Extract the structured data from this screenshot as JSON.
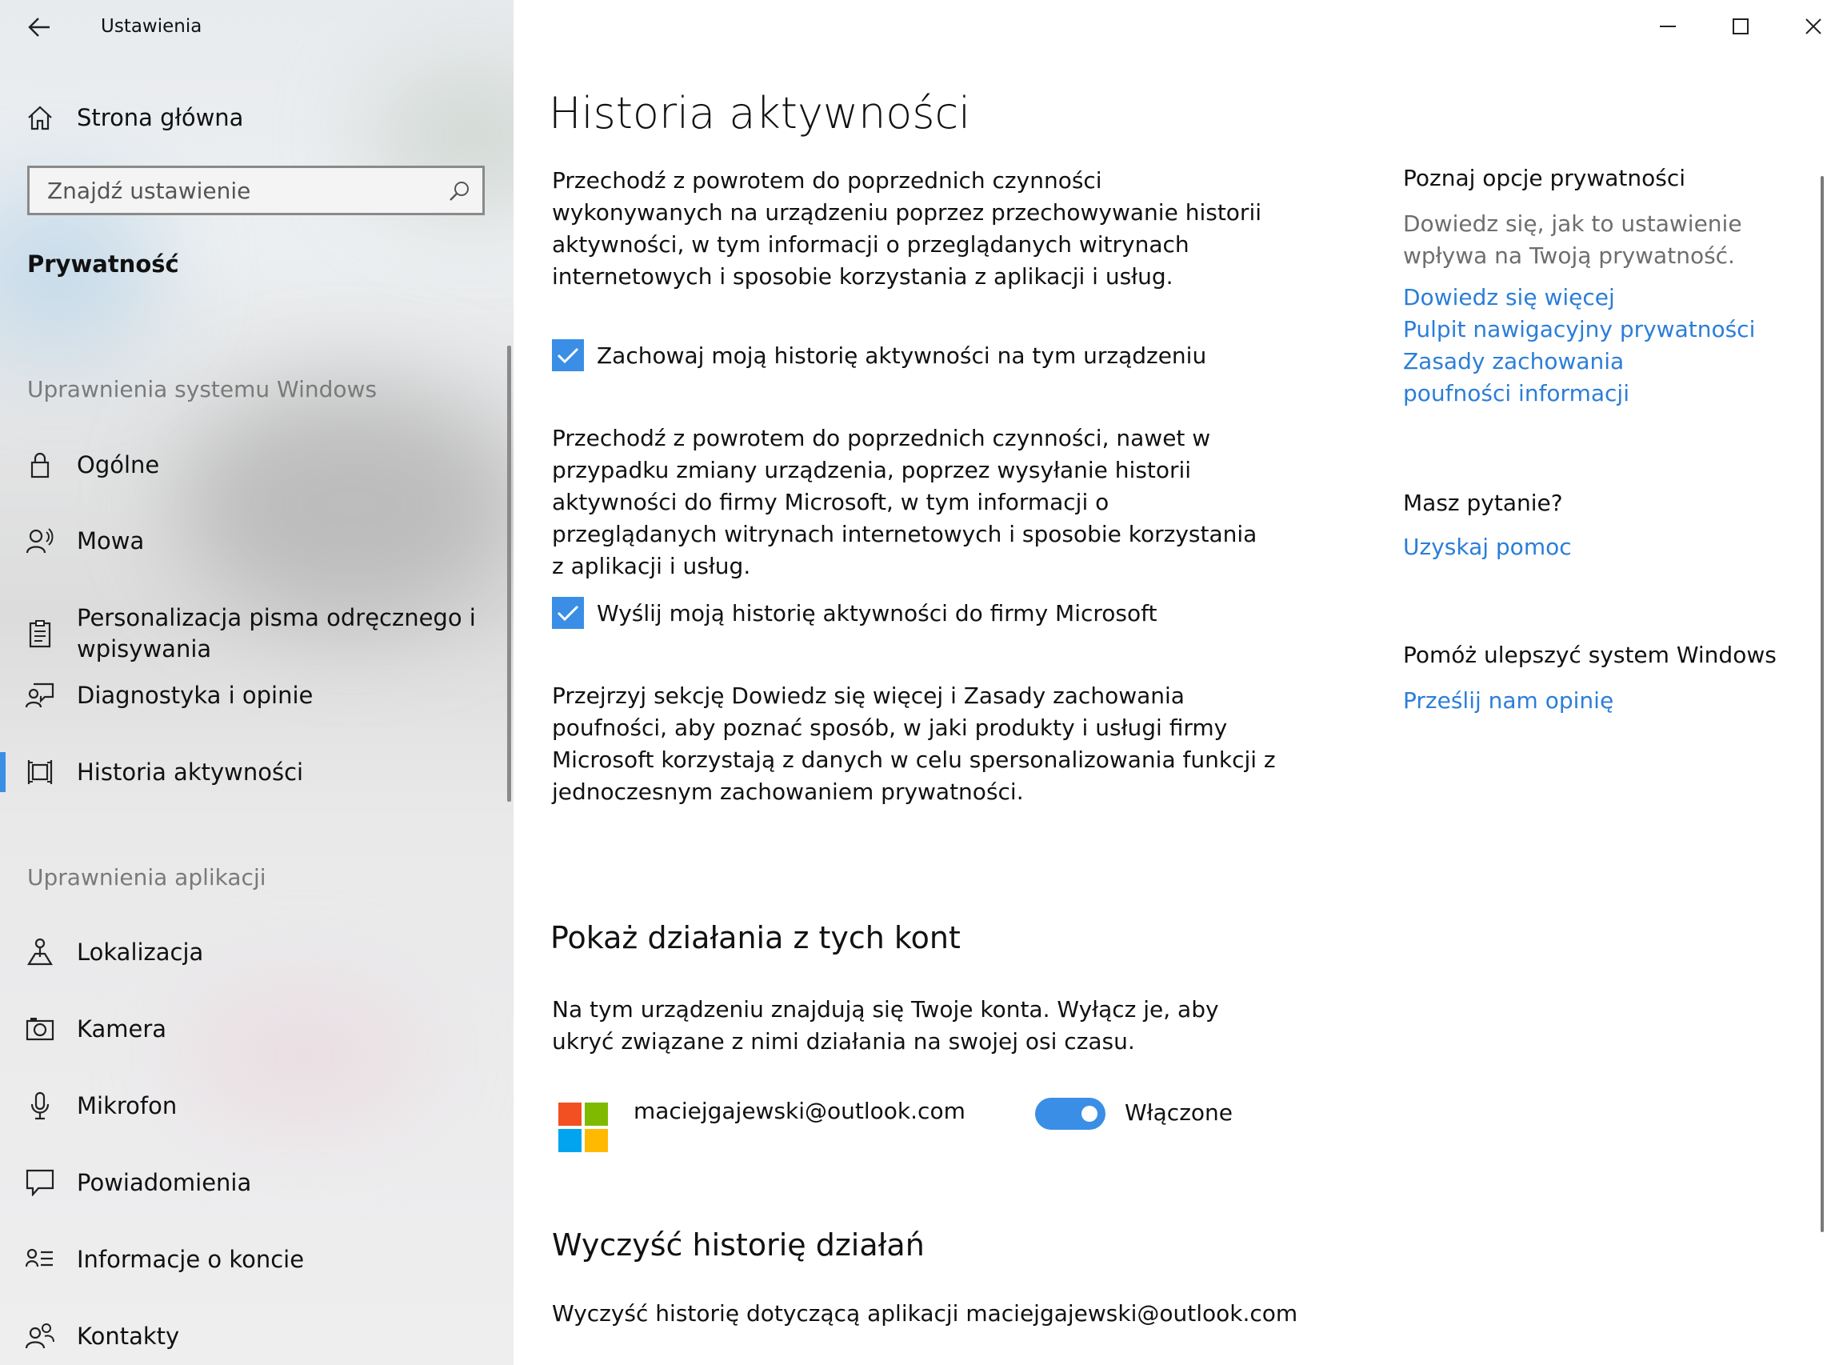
{
  "window": {
    "app_title": "Ustawienia"
  },
  "sidebar": {
    "home_label": "Strona główna",
    "search_placeholder": "Znajdź ustawienie",
    "category_title": "Prywatność",
    "section_windows": "Uprawnienia systemu Windows",
    "windows_items": [
      {
        "label": "Ogólne",
        "icon": "lock-icon"
      },
      {
        "label": "Mowa",
        "icon": "speech-icon"
      },
      {
        "label": "Personalizacja pisma odręcznego i wpisywania",
        "icon": "clipboard-icon"
      },
      {
        "label": "Diagnostyka i opinie",
        "icon": "feedback-icon"
      },
      {
        "label": "Historia aktywności",
        "icon": "timeline-icon",
        "active": true
      }
    ],
    "section_apps": "Uprawnienia aplikacji",
    "app_items": [
      {
        "label": "Lokalizacja",
        "icon": "location-icon"
      },
      {
        "label": "Kamera",
        "icon": "camera-icon"
      },
      {
        "label": "Mikrofon",
        "icon": "microphone-icon"
      },
      {
        "label": "Powiadomienia",
        "icon": "notification-icon"
      },
      {
        "label": "Informacje o koncie",
        "icon": "account-info-icon"
      },
      {
        "label": "Kontakty",
        "icon": "contacts-icon"
      }
    ]
  },
  "main": {
    "title": "Historia aktywności",
    "intro": "Przechodź z powrotem do poprzednich czynności wykonywanych na urządzeniu poprzez przechowywanie historii aktywności, w tym informacji o przeglądanych witrynach internetowych i sposobie korzystania z aplikacji i usług.",
    "checkbox_store": {
      "label": "Zachowaj moją historię aktywności na tym urządzeniu",
      "checked": true
    },
    "send_desc": "Przechodź z powrotem do poprzednich czynności, nawet w przypadku zmiany urządzenia, poprzez wysyłanie historii aktywności do firmy Microsoft, w tym informacji o przeglądanych witrynach internetowych i sposobie korzystania z aplikacji i usług.",
    "checkbox_send": {
      "label": "Wyślij moją historię aktywności do firmy Microsoft",
      "checked": true
    },
    "review_text": "Przejrzyj sekcję Dowiedz się więcej i Zasady zachowania poufności, aby poznać sposób, w jaki produkty i usługi firmy Microsoft korzystają z danych w celu spersonalizowania funkcji z jednoczesnym zachowaniem prywatności.",
    "accounts_heading": "Pokaż działania z tych kont",
    "accounts_desc": "Na tym urządzeniu znajdują się Twoje konta. Wyłącz je, aby ukryć związane z nimi działania na swojej osi czasu.",
    "account": {
      "email": "maciejgajewski@outlook.com",
      "toggle_label": "Włączone",
      "toggle_on": true
    },
    "clear_heading": "Wyczyść historię działań",
    "clear_desc": "Wyczyść historię dotyczącą aplikacji maciejgajewski@outlook.com"
  },
  "right": {
    "privacy_head": "Poznaj opcje prywatności",
    "privacy_text": "Dowiedz się, jak to ustawienie wpływa na Twoją prywatność.",
    "links": [
      "Dowiedz się więcej",
      "Pulpit nawigacyjny prywatności",
      "Zasady zachowania poufności informacji"
    ],
    "question_head": "Masz pytanie?",
    "help_link": "Uzyskaj pomoc",
    "improve_head": "Pomóż ulepszyć system Windows",
    "feedback_link": "Prześlij nam opinię"
  },
  "colors": {
    "accent": "#3a8ee6",
    "link": "#2b7ed8",
    "ms_red": "#f25022",
    "ms_green": "#7fba00",
    "ms_blue": "#00a4ef",
    "ms_yellow": "#ffb900"
  }
}
